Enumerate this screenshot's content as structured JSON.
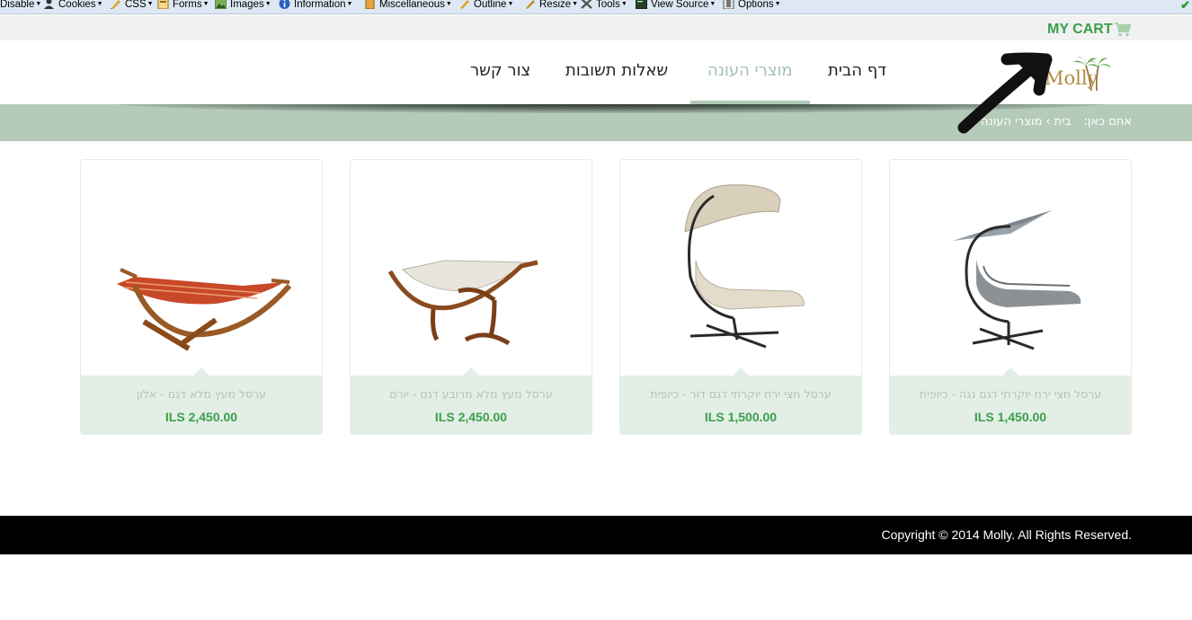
{
  "devtoolbar": {
    "items": [
      {
        "label": "Disable",
        "icon": "disable-icon"
      },
      {
        "label": "Cookies",
        "icon": "cookies-icon"
      },
      {
        "label": "CSS",
        "icon": "css-icon"
      },
      {
        "label": "Forms",
        "icon": "forms-icon"
      },
      {
        "label": "Images",
        "icon": "images-icon"
      },
      {
        "label": "Information",
        "icon": "information-icon"
      },
      {
        "label": "Miscellaneous",
        "icon": "miscellaneous-icon"
      },
      {
        "label": "Outline",
        "icon": "outline-icon"
      },
      {
        "label": "Resize",
        "icon": "resize-icon"
      },
      {
        "label": "Tools",
        "icon": "tools-icon"
      },
      {
        "label": "View Source",
        "icon": "view-source-icon"
      },
      {
        "label": "Options",
        "icon": "options-icon"
      }
    ]
  },
  "cart": {
    "label": "MY CART",
    "icon": "shopping-cart-icon"
  },
  "logo": {
    "text": "Molly",
    "icon": "palm-tree-logo"
  },
  "nav": {
    "items": [
      {
        "label": "דף הבית",
        "active": false
      },
      {
        "label": "מוצרי העונה",
        "active": true
      },
      {
        "label": "שאלות תשובות",
        "active": false
      },
      {
        "label": "צור קשר",
        "active": false
      }
    ]
  },
  "breadcrumb": {
    "prefix": "אתם כאן:",
    "home": "בית",
    "separator": "›",
    "current": "מוצרי העונה"
  },
  "products": [
    {
      "name": "ערסל חצי ירח יוקרתי דגם נגה - כיופית",
      "price": "ILS 1,450.00",
      "image": "grey-hanging-chaise-with-canopy"
    },
    {
      "name": "ערסל חצי ירח יוקרתי דגם דור - כיופית",
      "price": "ILS 1,500.00",
      "image": "beige-hanging-chaise-with-canopy"
    },
    {
      "name": "ערסל מעץ מלא מרובע דגם - יורם",
      "price": "ILS 2,450.00",
      "image": "square-wooden-hammock-with-canopy"
    },
    {
      "name": "ערסל מעץ מלא דגם - אלון",
      "price": "ILS 2,450.00",
      "image": "wooden-arc-hammock-striped"
    }
  ],
  "footer": {
    "copyright": "Copyright © 2014 Molly. All Rights Reserved."
  },
  "colors": {
    "accent_green": "#3aa04a",
    "band": "#b5cbb9",
    "card_info": "#e2eee6",
    "nav_active": "#a3c1ad"
  }
}
